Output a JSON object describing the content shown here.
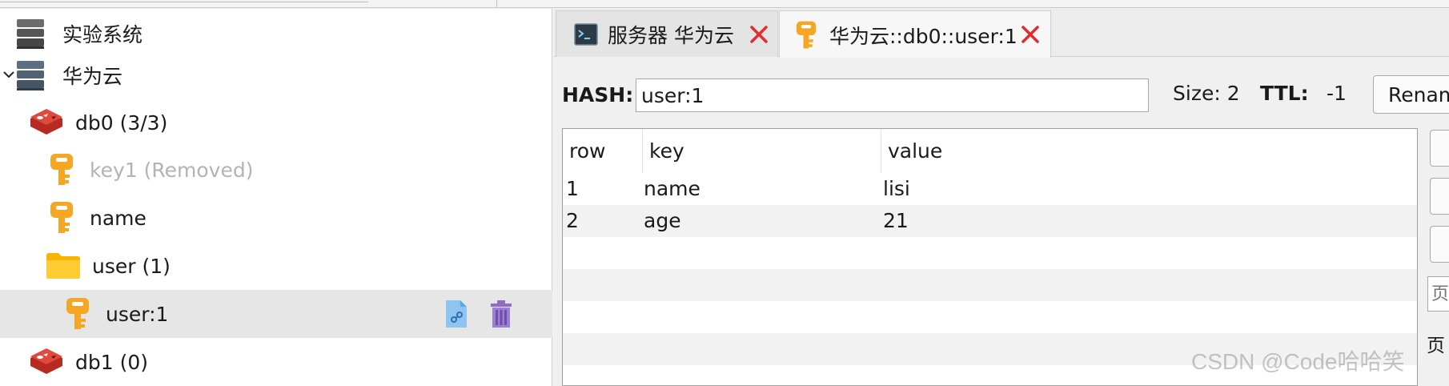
{
  "tree": {
    "items": [
      {
        "label": "实验系统",
        "icon": "server-stack-icon"
      },
      {
        "label": "华为云",
        "icon": "server-stack-icon",
        "expanded": true
      },
      {
        "label": "db0  (3/3)",
        "icon": "redis-db-icon"
      },
      {
        "label": "key1 (Removed)",
        "icon": "key-icon",
        "removed": true
      },
      {
        "label": "name",
        "icon": "key-icon"
      },
      {
        "label": "user (1)",
        "icon": "folder-icon"
      },
      {
        "label": "user:1",
        "icon": "key-icon",
        "selected": true
      },
      {
        "label": "db1 (0)",
        "icon": "redis-db-icon"
      }
    ]
  },
  "tabs": [
    {
      "label": "服务器 华为云",
      "icon": "terminal-icon",
      "active": false
    },
    {
      "label": "华为云::db0::user:1",
      "icon": "key-icon",
      "active": true
    }
  ],
  "editor": {
    "type_label": "HASH:",
    "key_value": "user:1",
    "size_text": "Size: 2",
    "ttl_label": "TTL:",
    "ttl_value": "-1",
    "rename_label": "Renam"
  },
  "table": {
    "columns": [
      "row",
      "key",
      "value"
    ],
    "rows": [
      {
        "row": "1",
        "key": "name",
        "value": "lisi"
      },
      {
        "row": "2",
        "key": "age",
        "value": "21"
      }
    ]
  },
  "page": {
    "input_placeholder": "页",
    "label": "页"
  },
  "watermark": "CSDN @Code哈哈笑",
  "colors": {
    "key_icon": "#f5a623",
    "redis_icon": "#d63b2f",
    "folder_icon": "#ffcc33",
    "close_x": "#e32b2b",
    "trash_icon": "#8e6cc8",
    "copy_icon": "#5aa7e6"
  }
}
